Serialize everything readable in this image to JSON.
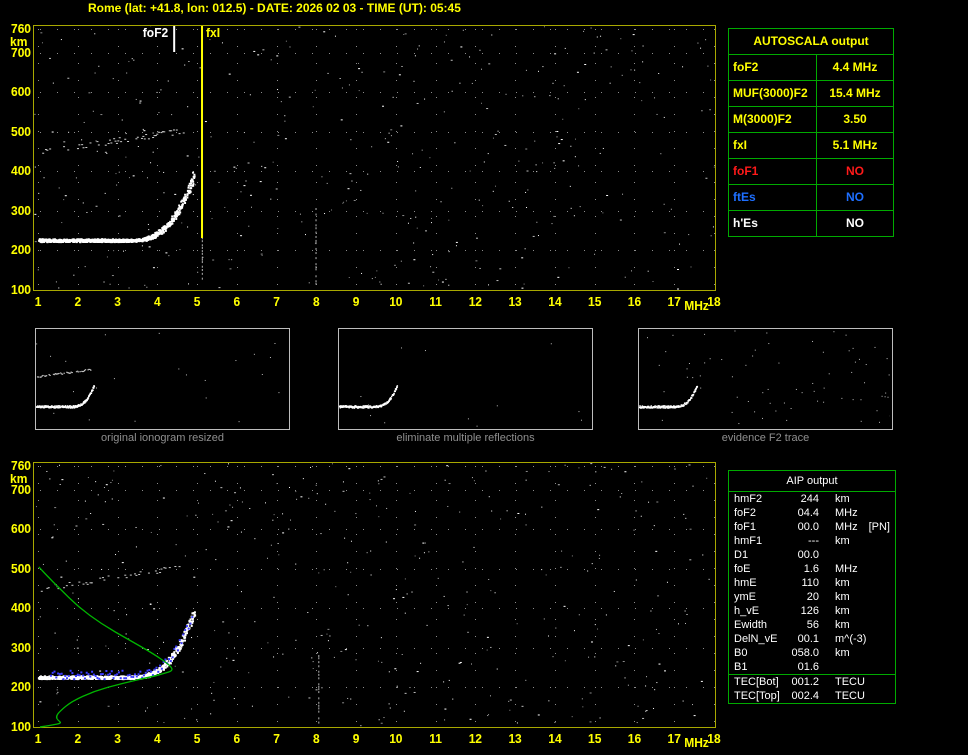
{
  "header": {
    "title": "Rome (lat: +41.8, lon: 012.5) - DATE: 2026 02 03 - TIME (UT): 05:45"
  },
  "autoscala_table": {
    "title": "AUTOSCALA output",
    "rows": [
      {
        "param": "foF2",
        "value": "4.4 MHz",
        "color": "#ffff00"
      },
      {
        "param": "MUF(3000)F2",
        "value": "15.4 MHz",
        "color": "#ffff00"
      },
      {
        "param": "M(3000)F2",
        "value": "3.50",
        "color": "#ffff00"
      },
      {
        "param": "fxI",
        "value": "5.1 MHz",
        "color": "#ffff00"
      },
      {
        "param": "foF1",
        "value": "NO",
        "color": "#ff1a1a"
      },
      {
        "param": "ftEs",
        "value": "NO",
        "color": "#1e6fff"
      },
      {
        "param": "h'Es",
        "value": "NO",
        "color": "#ffffff"
      }
    ]
  },
  "thumbnails": [
    {
      "caption": "original ionogram resized"
    },
    {
      "caption": "eliminate multiple reflections"
    },
    {
      "caption": "evidence F2 trace"
    }
  ],
  "aip_table": {
    "title": "AIP output",
    "rows": [
      {
        "param": "hmF2",
        "value": "244",
        "unit": "km",
        "note": ""
      },
      {
        "param": "foF2",
        "value": "04.4",
        "unit": "MHz",
        "note": ""
      },
      {
        "param": "foF1",
        "value": "00.0",
        "unit": "MHz",
        "note": "[PN]"
      },
      {
        "param": "hmF1",
        "value": "---",
        "unit": "km",
        "note": ""
      },
      {
        "param": "D1",
        "value": "00.0",
        "unit": "",
        "note": ""
      },
      {
        "param": "foE",
        "value": "1.6",
        "unit": "MHz",
        "note": ""
      },
      {
        "param": "hmE",
        "value": "110",
        "unit": "km",
        "note": ""
      },
      {
        "param": "ymE",
        "value": "20",
        "unit": "km",
        "note": ""
      },
      {
        "param": "h_vE",
        "value": "126",
        "unit": "km",
        "note": ""
      },
      {
        "param": "Ewidth",
        "value": "56",
        "unit": "km",
        "note": ""
      },
      {
        "param": "DelN_vE",
        "value": "00.1",
        "unit": "m^(-3)",
        "note": ""
      },
      {
        "param": "B0",
        "value": "058.0",
        "unit": "km",
        "note": ""
      },
      {
        "param": "B1",
        "value": "01.6",
        "unit": "",
        "note": ""
      },
      {
        "param": "TEC[Bot]",
        "value": "001.2",
        "unit": "TECU",
        "note": "",
        "divider_before": true
      },
      {
        "param": "TEC[Top]",
        "value": "002.4",
        "unit": "TECU",
        "note": ""
      }
    ]
  },
  "chart_data": [
    {
      "id": "top_ionogram",
      "type": "scatter",
      "title": "recorded ionogram with autoscaled characteristics",
      "xlabel": "MHz",
      "ylabel": "km",
      "xlim": [
        1,
        18
      ],
      "ylim": [
        100,
        760
      ],
      "x_ticks": [
        1,
        2,
        3,
        4,
        5,
        6,
        7,
        8,
        9,
        10,
        11,
        12,
        13,
        14,
        15,
        16,
        17,
        18
      ],
      "y_ticks": [
        760,
        700,
        600,
        500,
        400,
        300,
        200,
        100
      ],
      "grid": "dotted",
      "series": [
        {
          "name": "F2 echo trace",
          "kind": "band",
          "color": "#ffffff",
          "f_range": [
            1.0,
            4.92
          ],
          "base_height_km": 226,
          "rise_start_mhz": 3.2,
          "top_height_km": 390
        },
        {
          "name": "second hop echo",
          "kind": "sparse",
          "color": "#d0d0d0",
          "f_range": [
            1.0,
            4.8
          ],
          "h_range": [
            450,
            505
          ]
        }
      ],
      "markers": [
        {
          "label": "foF2",
          "frequency_mhz": 4.4,
          "color": "#ffffff",
          "line_length": "short"
        },
        {
          "label": "fxI",
          "frequency_mhz": 5.1,
          "color": "#ffff00",
          "line_length": "long"
        }
      ]
    },
    {
      "id": "bottom_ionogram",
      "type": "scatter",
      "title": "restored trace with electron density profile",
      "xlabel": "MHz",
      "ylabel": "km",
      "xlim": [
        1,
        18
      ],
      "ylim": [
        100,
        760
      ],
      "x_ticks": [
        1,
        2,
        3,
        4,
        5,
        6,
        7,
        8,
        9,
        10,
        11,
        12,
        13,
        14,
        15,
        16,
        17,
        18
      ],
      "y_ticks": [
        760,
        700,
        600,
        500,
        400,
        300,
        200,
        100
      ],
      "grid": "dotted",
      "series": [
        {
          "name": "F2 echo trace",
          "kind": "band",
          "color": "#ffffff",
          "f_range": [
            1.0,
            4.92
          ],
          "base_height_km": 226,
          "rise_start_mhz": 3.2,
          "top_height_km": 390
        },
        {
          "name": "second hop echo",
          "kind": "sparse",
          "color": "#c8c8c8",
          "f_range": [
            1.0,
            4.6
          ],
          "h_range": [
            450,
            505
          ]
        },
        {
          "name": "autoscaled trace points",
          "kind": "dots",
          "color": "#3c3cff",
          "f_range": [
            1.3,
            4.88
          ]
        }
      ],
      "profile": {
        "name": "electron density profile N(h)",
        "color": "#00b400",
        "points_f_h": [
          [
            1.05,
            100
          ],
          [
            1.35,
            104
          ],
          [
            1.6,
            110
          ],
          [
            1.5,
            117
          ],
          [
            1.45,
            126
          ],
          [
            1.55,
            140
          ],
          [
            1.85,
            165
          ],
          [
            2.4,
            190
          ],
          [
            3.1,
            210
          ],
          [
            3.8,
            226
          ],
          [
            4.25,
            237
          ],
          [
            4.4,
            244
          ],
          [
            4.3,
            258
          ],
          [
            3.9,
            285
          ],
          [
            3.3,
            320
          ],
          [
            2.6,
            360
          ],
          [
            2.0,
            405
          ],
          [
            1.55,
            450
          ],
          [
            1.2,
            485
          ],
          [
            1.02,
            505
          ]
        ]
      }
    }
  ]
}
